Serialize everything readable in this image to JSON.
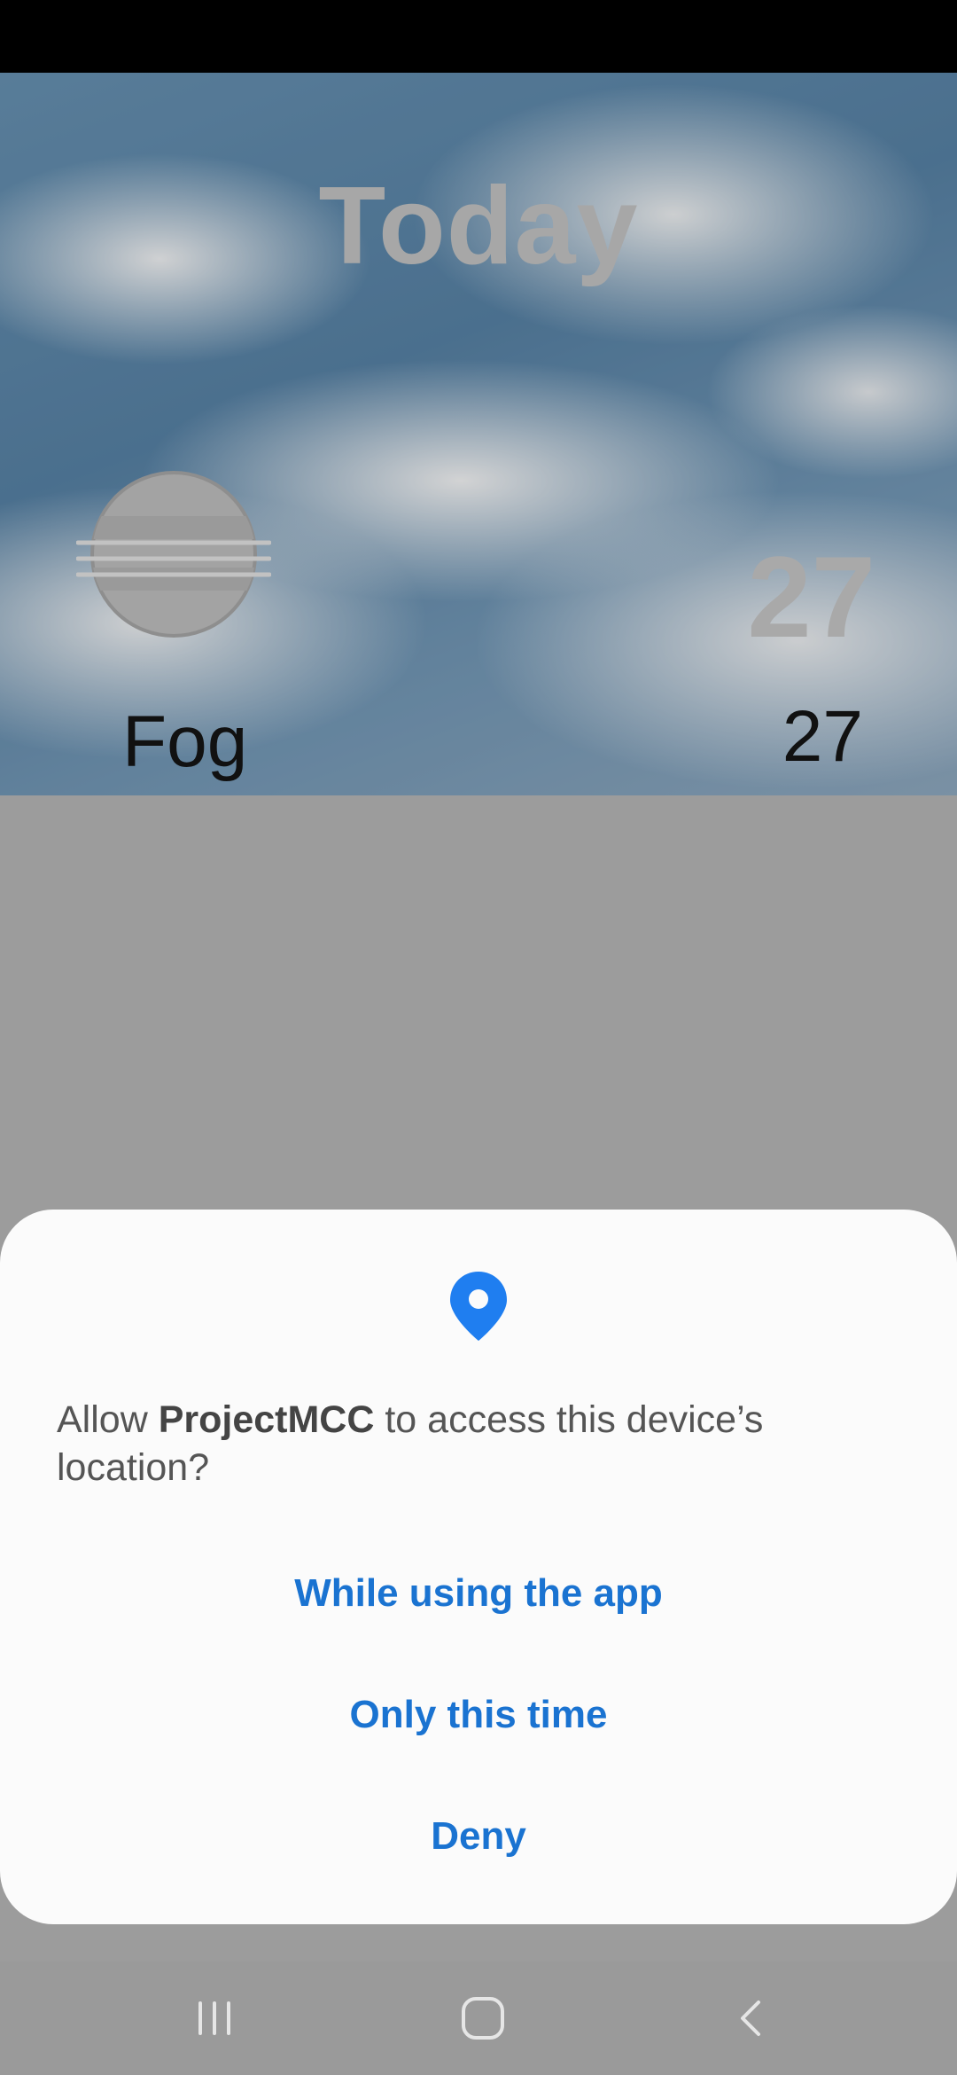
{
  "weather": {
    "title": "Today",
    "temp_large": "27",
    "condition": "Fog",
    "temp_small": "27",
    "condition_icon": "fog-icon"
  },
  "permission_dialog": {
    "icon": "location-pin-icon",
    "prompt_prefix": "Allow ",
    "app_name": "ProjectMCC",
    "prompt_suffix": " to access this device’s location?",
    "options": [
      {
        "label": "While using the app"
      },
      {
        "label": "Only this time"
      },
      {
        "label": "Deny"
      }
    ],
    "accent_color": "#1a73d1"
  },
  "nav_bar": {
    "recents_icon": "recents-icon",
    "home_icon": "home-icon",
    "back_icon": "back-icon"
  }
}
